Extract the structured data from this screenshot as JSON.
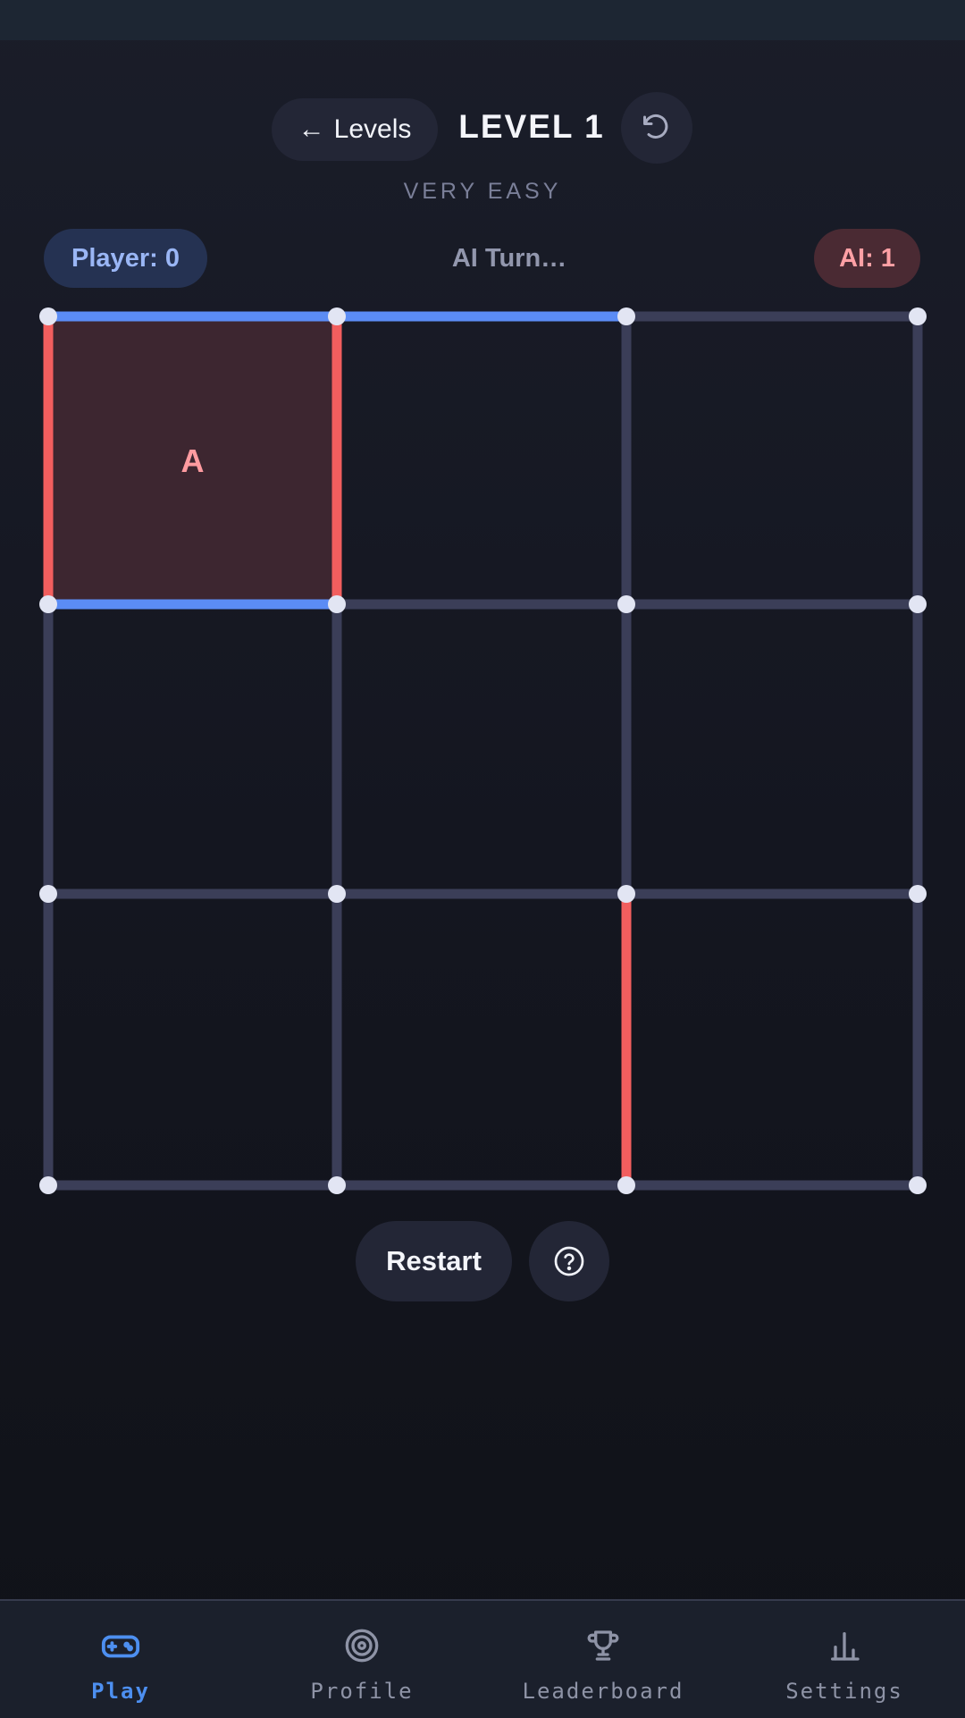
{
  "header": {
    "back_label": "Levels",
    "back_arrow": "←",
    "level_title": "LEVEL 1",
    "undo_icon": "undo-icon",
    "difficulty": "VERY EASY"
  },
  "score": {
    "player": "Player: 0",
    "turn_status": "AI Turn…",
    "ai": "AI: 1"
  },
  "board": {
    "rows": 3,
    "cols": 3,
    "owned_box_letter": "A",
    "owned_box": {
      "row": 0,
      "col": 0,
      "owner": "ai"
    },
    "player_edges": [
      "h-0-0",
      "h-0-1",
      "h-1-0"
    ],
    "ai_edges": [
      "v-0-0",
      "v-0-1",
      "v-2-2"
    ],
    "colors": {
      "player": "#5b8cf5",
      "ai": "#f25e5e",
      "empty": "#3b3e58",
      "dot": "#e2e5f3",
      "owned_box": "#3d2630"
    }
  },
  "actions": {
    "restart_label": "Restart",
    "help_icon": "help-circle-icon"
  },
  "nav": {
    "items": [
      {
        "label": "Play",
        "icon": "gamepad-icon",
        "active": true
      },
      {
        "label": "Profile",
        "icon": "target-icon",
        "active": false
      },
      {
        "label": "Leaderboard",
        "icon": "trophy-icon",
        "active": false
      },
      {
        "label": "Settings",
        "icon": "bar-chart-icon",
        "active": false
      }
    ],
    "active_color": "#4d8ff0"
  }
}
